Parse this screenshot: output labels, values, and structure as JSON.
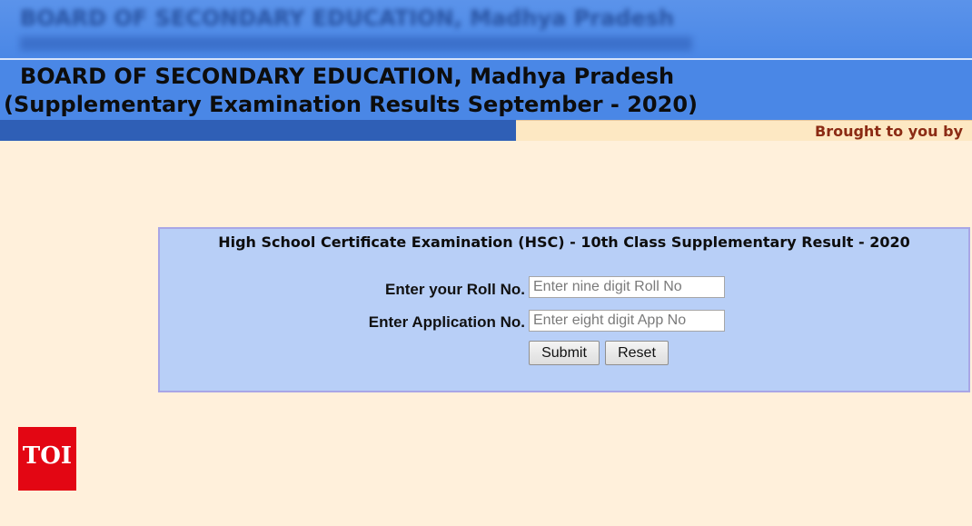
{
  "banner": {
    "blurred_text": "BOARD OF SECONDARY EDUCATION, Madhya Pradesh"
  },
  "header": {
    "title": "BOARD OF SECONDARY EDUCATION, Madhya Pradesh",
    "subtitle": "(Supplementary Examination Results September - 2020)"
  },
  "strip": {
    "marquee": "Brought to you by"
  },
  "form": {
    "title": "High School Certificate Examination (HSC) - 10th Class Supplementary Result - 2020",
    "roll_label": "Enter your Roll No.",
    "roll_placeholder": "Enter nine digit Roll No",
    "roll_value": "",
    "app_label": "Enter Application No.",
    "app_placeholder": "Enter eight digit App No",
    "app_value": "",
    "submit_label": "Submit",
    "reset_label": "Reset"
  },
  "logo": {
    "text": "TOI",
    "color": "#e30613"
  },
  "colors": {
    "header_blue": "#4a87e6",
    "strip_blue": "#2f5fb6",
    "page_bg": "#fff0db",
    "panel_bg": "#b8cff7",
    "marquee_text": "#8b2b14"
  }
}
